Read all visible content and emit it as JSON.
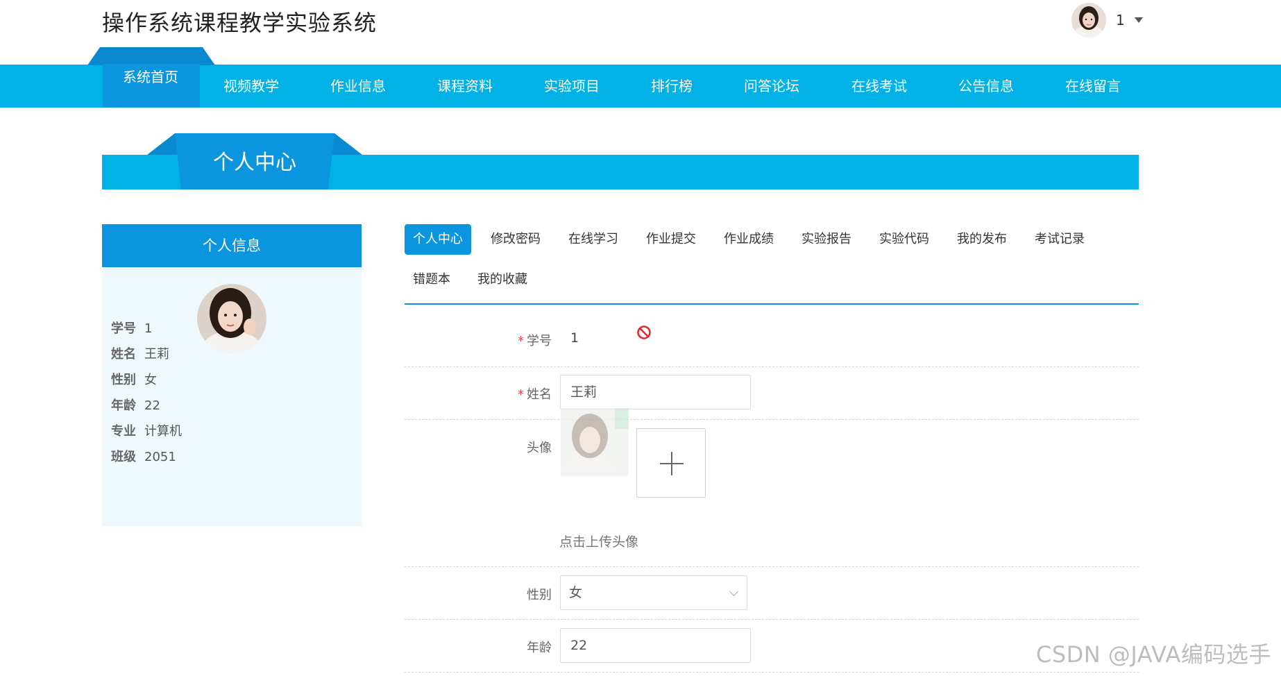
{
  "header": {
    "site_title": "操作系统课程教学实验系统",
    "user_name": "1"
  },
  "nav": {
    "items": [
      {
        "label": "系统首页",
        "active": true
      },
      {
        "label": "视频教学"
      },
      {
        "label": "作业信息"
      },
      {
        "label": "课程资料"
      },
      {
        "label": "实验项目"
      },
      {
        "label": "排行榜"
      },
      {
        "label": "问答论坛"
      },
      {
        "label": "在线考试"
      },
      {
        "label": "公告信息"
      },
      {
        "label": "在线留言"
      }
    ]
  },
  "section": {
    "title": "个人中心"
  },
  "profile_card": {
    "header": "个人信息",
    "rows": [
      {
        "label": "学号",
        "value": "1"
      },
      {
        "label": "姓名",
        "value": "王莉"
      },
      {
        "label": "性别",
        "value": "女"
      },
      {
        "label": "年龄",
        "value": "22"
      },
      {
        "label": "专业",
        "value": "计算机"
      },
      {
        "label": "班级",
        "value": "2051"
      }
    ]
  },
  "tabs": [
    {
      "label": "个人中心",
      "active": true
    },
    {
      "label": "修改密码"
    },
    {
      "label": "在线学习"
    },
    {
      "label": "作业提交"
    },
    {
      "label": "作业成绩"
    },
    {
      "label": "实验报告"
    },
    {
      "label": "实验代码"
    },
    {
      "label": "我的发布"
    },
    {
      "label": "考试记录"
    },
    {
      "label": "错题本"
    },
    {
      "label": "我的收藏"
    }
  ],
  "form": {
    "student_id": {
      "label": "学号",
      "value": "1",
      "required": true
    },
    "name": {
      "label": "姓名",
      "value": "王莉",
      "required": true
    },
    "avatar": {
      "label": "头像",
      "hint": "点击上传头像"
    },
    "gender": {
      "label": "性别",
      "value": "女"
    },
    "age": {
      "label": "年龄",
      "value": "22"
    }
  },
  "watermark": "CSDN @JAVA编码选手",
  "colors": {
    "nav": "#02b2e6",
    "accent": "#0b95df",
    "accent_dark": "#0a89d0",
    "required": "#e84545",
    "ban": "#e0282e"
  }
}
